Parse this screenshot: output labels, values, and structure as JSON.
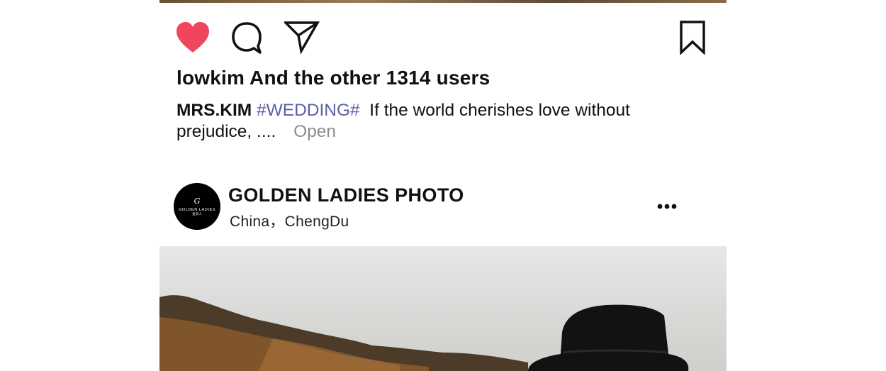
{
  "post_actions": {
    "like_icon": "heart-filled-icon",
    "comment_icon": "speech-bubble-icon",
    "share_icon": "paper-plane-icon",
    "save_icon": "bookmark-icon",
    "like_color": "#f0465b"
  },
  "likes": {
    "text": "lowkim And the other 1314 users"
  },
  "caption": {
    "author": "MRS.KIM",
    "hashtag": "#WEDDING#",
    "text": "If the world cherishes love without prejudice, ....",
    "open_label": "Open",
    "hashtag_color": "#5b5fa3"
  },
  "next_post": {
    "avatar_logo_mark": "G",
    "avatar_logo_text": "GOLDEN LADIES",
    "avatar_logo_subtext": "金夫人",
    "account_name": "GOLDEN LADIES PHOTO",
    "location": "China，ChengDu",
    "more_icon": "ellipsis-horizontal-icon"
  }
}
